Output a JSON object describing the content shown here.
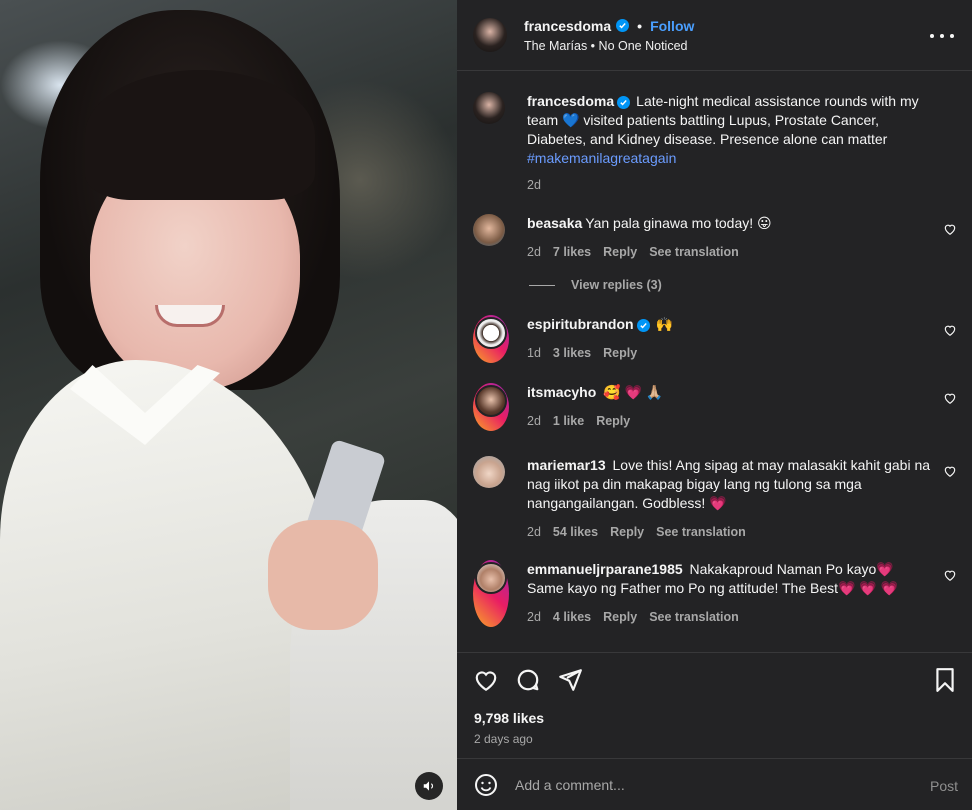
{
  "post": {
    "username": "francesdoma",
    "follow_label": "Follow",
    "separator": "•",
    "audio": "The Marías • No One Noticed",
    "caption": {
      "username": "francesdoma",
      "text": "Late-night medical assistance rounds with my team 💙 visited patients battling Lupus, Prostate Cancer, Diabetes, and Kidney disease. Presence alone can matter",
      "hashtag": "#makemanilagreatagain",
      "time": "2d"
    }
  },
  "comments": [
    {
      "username": "beasaka",
      "text": "Yan pala ginawa mo today! 😛",
      "time": "2d",
      "likes": "7 likes",
      "reply": "Reply",
      "translation": "See translation"
    },
    {
      "username": "espiritubrandon",
      "text": "🙌",
      "time": "1d",
      "likes": "3 likes",
      "reply": "Reply"
    },
    {
      "username": "itsmacyho",
      "text": "🥰 💗 🙏🏼",
      "time": "2d",
      "likes": "1 like",
      "reply": "Reply"
    },
    {
      "username": "mariemar13",
      "text": "Love this! Ang sipag at may malasakit kahit gabi na nag iikot pa din makapag bigay lang ng tulong sa mga nangangailangan. Godbless! 💗",
      "time": "2d",
      "likes": "54 likes",
      "reply": "Reply",
      "translation": "See translation"
    },
    {
      "username": "emmanueljrparane1985",
      "text": "Nakakaproud Naman Po kayo💗 Same kayo ng Father mo Po ng attitude! The Best💗 💗 💗",
      "time": "2d",
      "likes": "4 likes",
      "reply": "Reply",
      "translation": "See translation"
    }
  ],
  "view_replies": "View replies (3)",
  "stats": {
    "likes": "9,798 likes",
    "ago": "2 days ago"
  },
  "composer": {
    "placeholder": "Add a comment...",
    "post_label": "Post"
  },
  "icons": [
    "heart-icon",
    "comment-icon",
    "share-icon",
    "bookmark-icon",
    "emoji-icon",
    "more-icon",
    "sound-icon",
    "verified-icon"
  ],
  "colors": {
    "panel": "#232325",
    "link": "#4a9fff",
    "verified": "#0095f6",
    "muted": "#a8a8a8"
  }
}
